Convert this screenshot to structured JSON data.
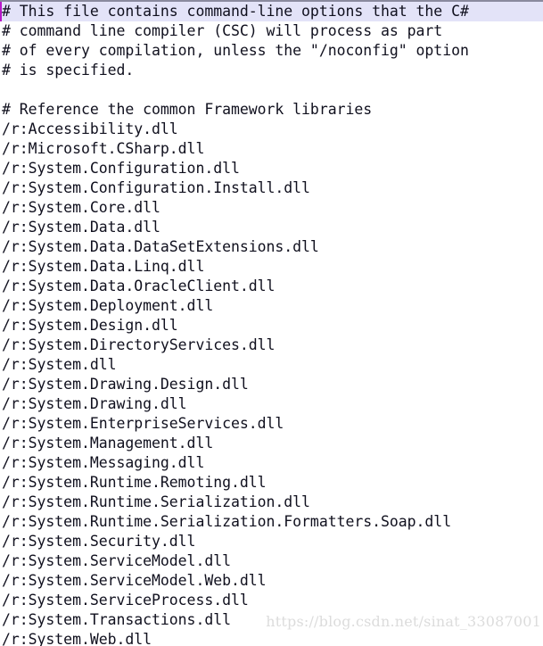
{
  "editor": {
    "name": "code-editor",
    "file_type": "csc.rsp response file",
    "cursor": {
      "line": 1,
      "column": 1,
      "color": "#b818c8"
    },
    "current_line_highlight_color": "#e3e3f8",
    "text_color": "#10101e",
    "background_color": "#ffffff",
    "top_border_color": "#8a8a9e"
  },
  "lines": [
    "# This file contains command-line options that the C#",
    "# command line compiler (CSC) will process as part",
    "# of every compilation, unless the \"/noconfig\" option",
    "# is specified.",
    "",
    "# Reference the common Framework libraries",
    "/r:Accessibility.dll",
    "/r:Microsoft.CSharp.dll",
    "/r:System.Configuration.dll",
    "/r:System.Configuration.Install.dll",
    "/r:System.Core.dll",
    "/r:System.Data.dll",
    "/r:System.Data.DataSetExtensions.dll",
    "/r:System.Data.Linq.dll",
    "/r:System.Data.OracleClient.dll",
    "/r:System.Deployment.dll",
    "/r:System.Design.dll",
    "/r:System.DirectoryServices.dll",
    "/r:System.dll",
    "/r:System.Drawing.Design.dll",
    "/r:System.Drawing.dll",
    "/r:System.EnterpriseServices.dll",
    "/r:System.Management.dll",
    "/r:System.Messaging.dll",
    "/r:System.Runtime.Remoting.dll",
    "/r:System.Runtime.Serialization.dll",
    "/r:System.Runtime.Serialization.Formatters.Soap.dll",
    "/r:System.Security.dll",
    "/r:System.ServiceModel.dll",
    "/r:System.ServiceModel.Web.dll",
    "/r:System.ServiceProcess.dll",
    "/r:System.Transactions.dll",
    "/r:System.Web.dll"
  ],
  "watermark": {
    "text": "https://blog.csdn.net/sinat_33087001"
  }
}
